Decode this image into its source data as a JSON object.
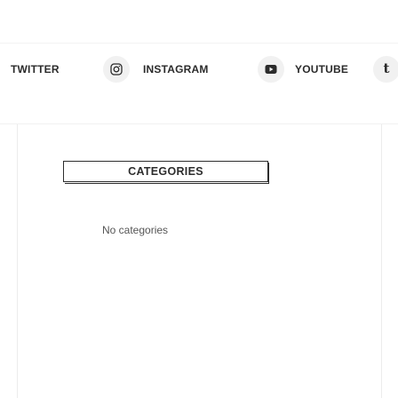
{
  "social": {
    "twitter_label": "TWITTER",
    "instagram_label": "INSTAGRAM",
    "youtube_label": "YOUTUBE",
    "tumblr_glyph": "t",
    "icons": {
      "instagram": "instagram-icon",
      "youtube": "youtube-icon",
      "tumblr": "tumblr-icon"
    }
  },
  "widget": {
    "title": "CATEGORIES",
    "empty_text": "No categories"
  },
  "colors": {
    "text": "#2b2b2b",
    "icon_bg": "#f1f1f1",
    "border": "#2d2d2d",
    "muted": "#555555"
  }
}
